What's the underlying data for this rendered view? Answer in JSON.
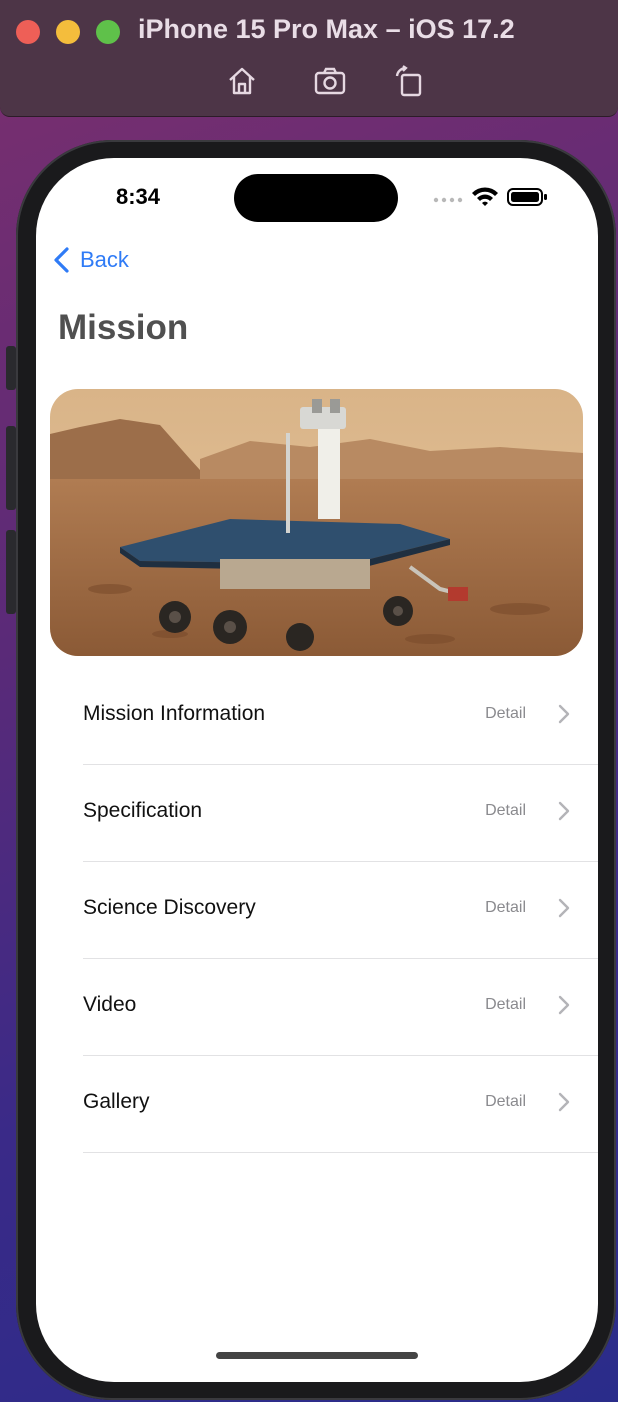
{
  "simulator": {
    "title": "iPhone 15 Pro Max – iOS 17.2",
    "tools": [
      "home-icon",
      "screenshot-icon",
      "rotate-icon"
    ]
  },
  "status_bar": {
    "time": "8:34"
  },
  "nav": {
    "back_label": "Back",
    "title": "Mission"
  },
  "hero": {
    "icon": "mars-rover-image"
  },
  "rows": [
    {
      "label": "Mission Information",
      "detail": "Detail"
    },
    {
      "label": "Specification",
      "detail": "Detail"
    },
    {
      "label": "Science Discovery",
      "detail": "Detail"
    },
    {
      "label": "Video",
      "detail": "Detail"
    },
    {
      "label": "Gallery",
      "detail": "Detail"
    }
  ],
  "colors": {
    "accent": "#2f7bf6",
    "title_text": "#505050",
    "detail_text": "#8a8a8e"
  }
}
